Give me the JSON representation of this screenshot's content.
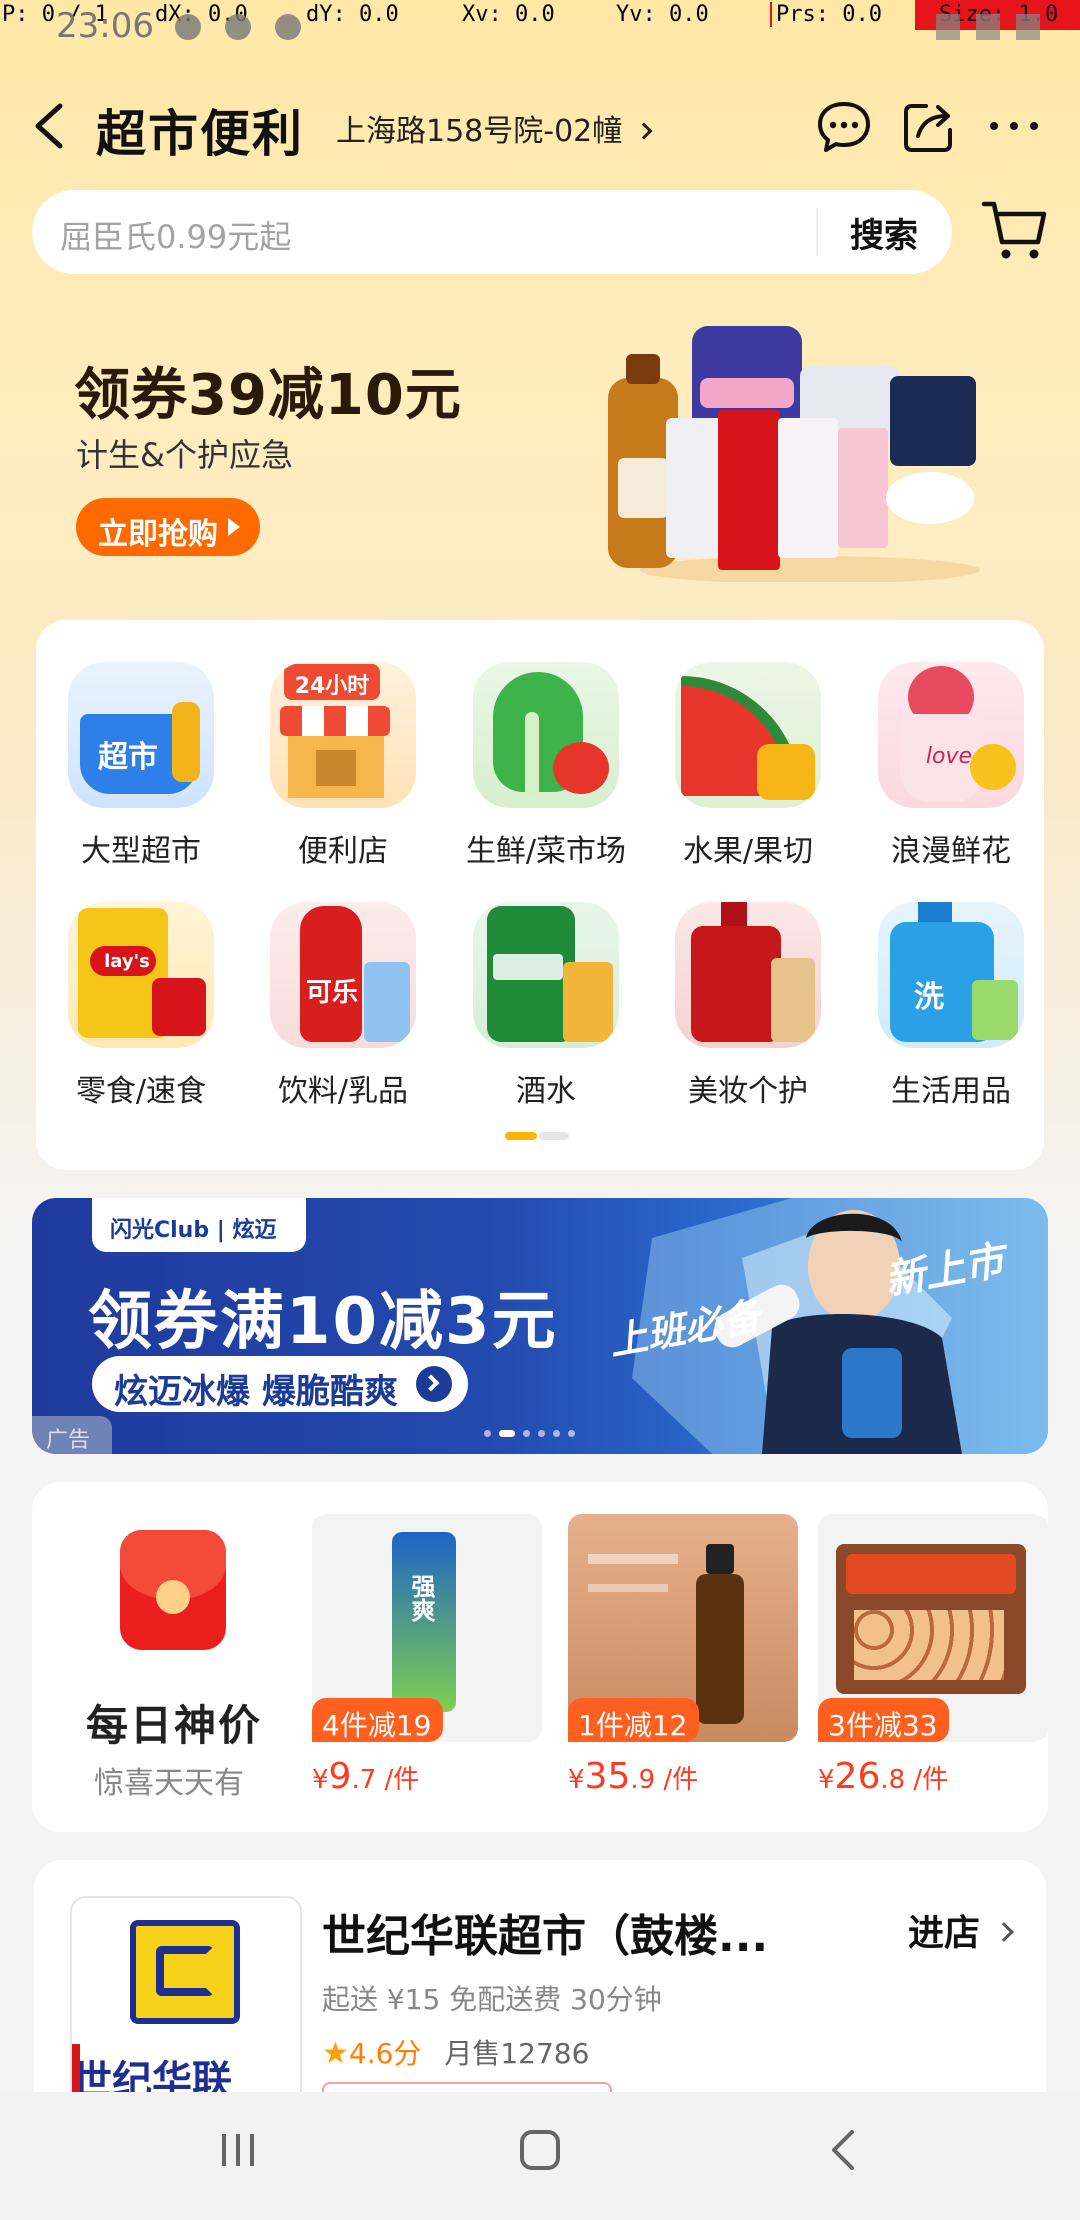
{
  "debug": {
    "p": "P: 0 / 1",
    "dx": "dX: 0.0",
    "dy": "dY: 0.0",
    "xv": "Xv: 0.0",
    "yv": "Yv: 0.0",
    "prs": "Prs: 0.0",
    "size": "Size: 1.0"
  },
  "status_bar": {
    "time": "23:06"
  },
  "header": {
    "title": "超市便利",
    "address": "上海路158号院-02幢",
    "icons": [
      "back-icon",
      "chat-icon",
      "share-icon",
      "more-icon"
    ]
  },
  "search": {
    "placeholder": "屈臣氏0.99元起",
    "button": "搜索"
  },
  "promo": {
    "headline": "领券39减10元",
    "subtitle": "计生&个护应急",
    "cta": "立即抢购"
  },
  "categories": {
    "items": [
      {
        "label": "大型超市",
        "icon": "supermarket-basket-icon",
        "color": "#2f7fe8"
      },
      {
        "label": "便利店",
        "icon": "convenience-store-icon",
        "color": "#f4a23a"
      },
      {
        "label": "生鲜/菜市场",
        "icon": "vegetable-icon",
        "color": "#3db34a"
      },
      {
        "label": "水果/果切",
        "icon": "watermelon-icon",
        "color": "#e8352b"
      },
      {
        "label": "浪漫鲜花",
        "icon": "rose-flower-icon",
        "color": "#e84a5f"
      },
      {
        "label": "零食/速食",
        "icon": "snack-chips-icon",
        "color": "#f5c518"
      },
      {
        "label": "饮料/乳品",
        "icon": "cola-bottle-icon",
        "color": "#d81e1e"
      },
      {
        "label": "酒水",
        "icon": "beer-can-icon",
        "color": "#1f8a3a"
      },
      {
        "label": "美妆个护",
        "icon": "cosmetics-bottle-icon",
        "color": "#c8161d"
      },
      {
        "label": "生活用品",
        "icon": "detergent-icon",
        "color": "#2aa0e6"
      }
    ],
    "page_index": 0,
    "page_count": 2
  },
  "ad_banner": {
    "brand": "闪光Club | 炫迈",
    "headline": "领券满10减3元",
    "sub": "炫迈冰爆 爆脆酷爽",
    "tag_left": "上班必备",
    "tag_right": "新上市",
    "ad_label": "广告"
  },
  "daily_deals": {
    "title": "每日神价",
    "subtitle": "惊喜天天有",
    "products": [
      {
        "badge": "4件减19",
        "currency": "¥",
        "price_int": "9",
        "price_dec": ".7 /件",
        "icon": "drink-can-icon"
      },
      {
        "badge": "1件减12",
        "currency": "¥",
        "price_int": "35",
        "price_dec": ".9 /件",
        "icon": "skincare-bottle-icon"
      },
      {
        "badge": "3件减33",
        "currency": "¥",
        "price_int": "26",
        "price_dec": ".8 /件",
        "icon": "egg-box-icon"
      }
    ]
  },
  "store": {
    "name": "世纪华联超市（鼓楼...",
    "enter": "进店",
    "meta": "起送 ¥15  免配送费  30分钟",
    "rating": "4.6分",
    "sales": "月售12786",
    "logo_text": "世纪华联"
  },
  "nav": {
    "icons": [
      "recent-apps-icon",
      "home-icon",
      "back-nav-icon"
    ]
  },
  "colors": {
    "accent": "#ff6a00",
    "price": "#ff3b1f",
    "banner_blue": "#234aaf"
  }
}
